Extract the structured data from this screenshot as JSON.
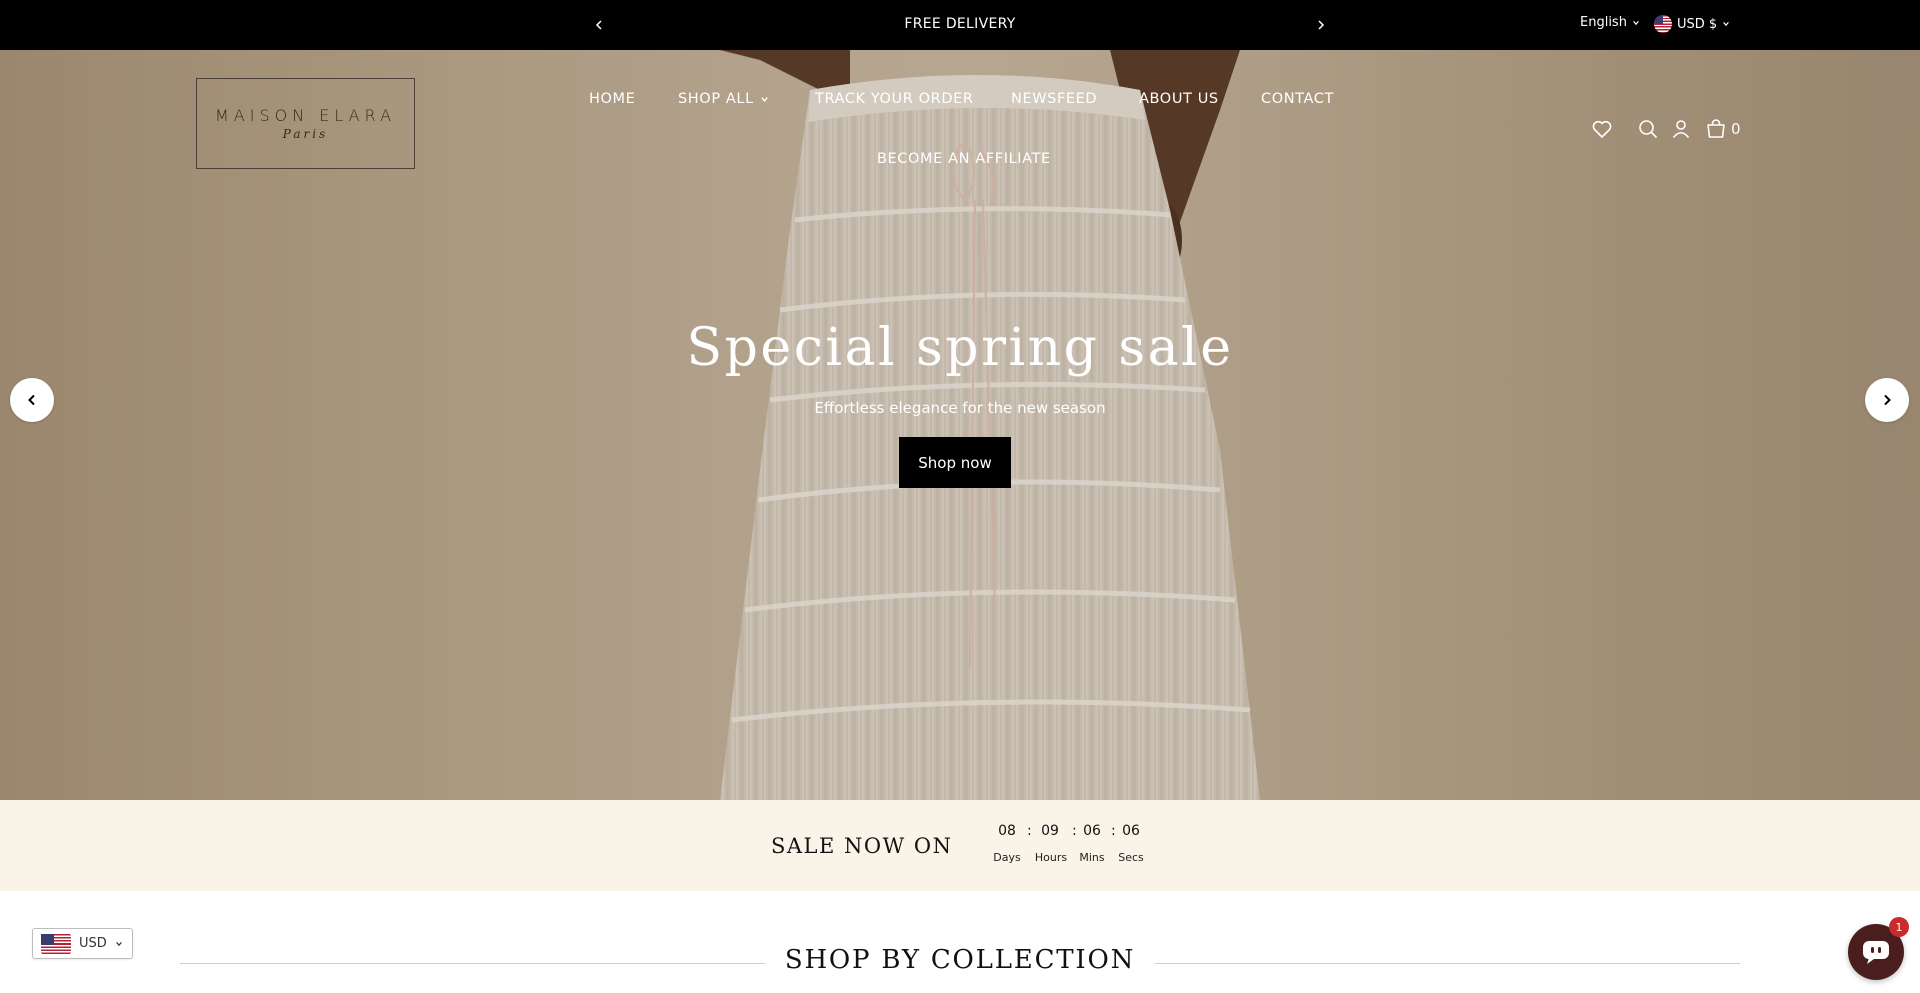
{
  "announcement": {
    "message": "FREE DELIVERY",
    "language": "English",
    "currency": "USD $"
  },
  "brand": {
    "name": "MAISON ELARA",
    "city": "Paris"
  },
  "nav": {
    "home": "HOME",
    "shop_all": "SHOP ALL",
    "track_order": "TRACK YOUR ORDER",
    "newsfeed": "NEWSFEED",
    "about": "ABOUT US",
    "contact": "CONTACT",
    "affiliate": "BECOME AN AFFILIATE"
  },
  "header": {
    "cart_count": "0"
  },
  "hero": {
    "title": "Special spring sale",
    "subtitle": "Effortless elegance for the new season",
    "button": "Shop now"
  },
  "countdown": {
    "title": "SALE NOW ON",
    "days": "08",
    "days_label": "Days",
    "hours": "09",
    "hours_label": "Hours",
    "mins": "06",
    "mins_label": "Mins",
    "secs": "06",
    "secs_label": "Secs",
    "separator": ":"
  },
  "collection": {
    "title": "SHOP BY COLLECTION"
  },
  "currency_widget": {
    "code": "USD"
  },
  "chat": {
    "badge": "1"
  },
  "colors": {
    "announce_bg": "#000000",
    "countdown_bg": "#faf3e8",
    "chat_bg": "#4a1d1f",
    "badge": "#c92a2a"
  }
}
